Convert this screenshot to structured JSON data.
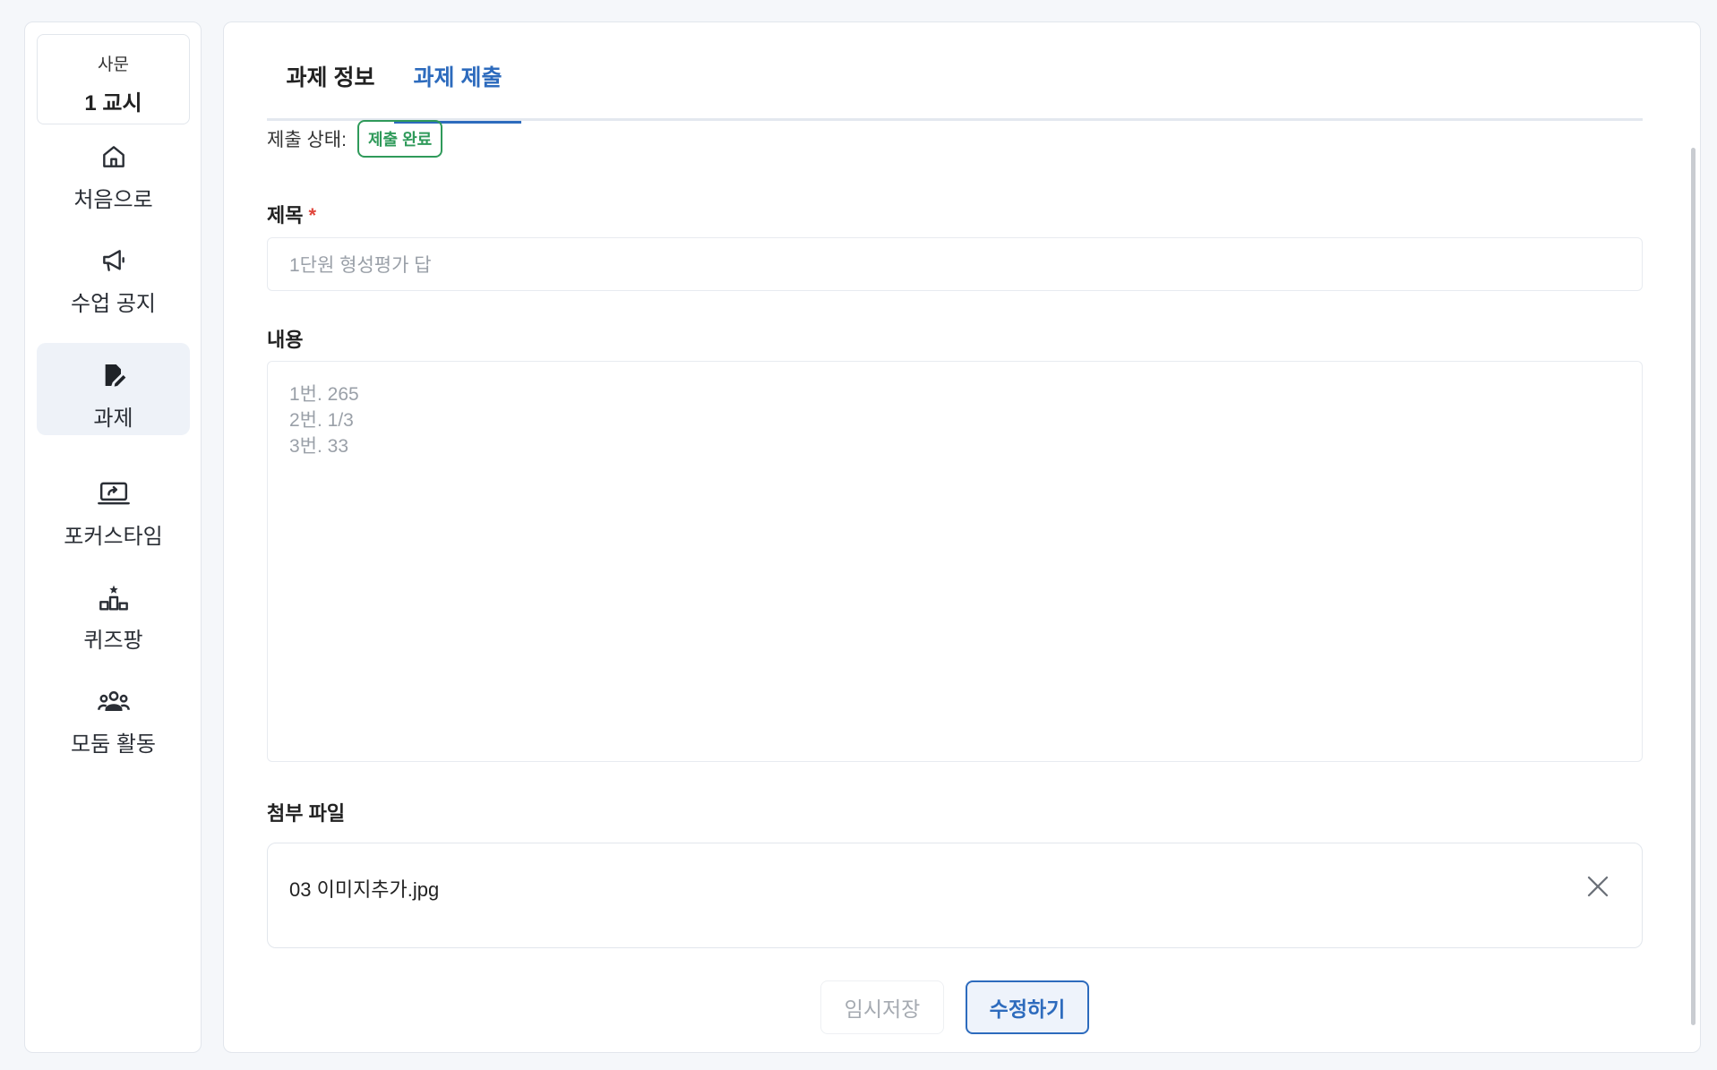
{
  "sidebar": {
    "class_card": {
      "subject": "사문",
      "period": "1 교시"
    },
    "items": [
      {
        "label": "처음으로",
        "icon": "home-icon"
      },
      {
        "label": "수업 공지",
        "icon": "megaphone-icon"
      },
      {
        "label": "과제",
        "icon": "assignment-edit-icon",
        "active": true
      },
      {
        "label": "포커스타임",
        "icon": "laptop-share-icon"
      },
      {
        "label": "퀴즈팡",
        "icon": "podium-star-icon"
      },
      {
        "label": "모둠 활동",
        "icon": "group-icon"
      }
    ]
  },
  "tabs": {
    "info": "과제 정보",
    "submit": "과제 제출",
    "active": "submit"
  },
  "status": {
    "label": "제출 상태:",
    "badge": "제출 완료",
    "badge_color": "#2f9a5a"
  },
  "form": {
    "title_label": "제목",
    "required_mark": "*",
    "title_value": "1단원 형성평가 답",
    "content_label": "내용",
    "content_value": "1번. 265\n2번. 1/3\n3번. 33",
    "attachment_label": "첨부 파일",
    "attachment_file": "03 이미지추가.jpg"
  },
  "buttons": {
    "draft": "임시저장",
    "edit": "수정하기"
  },
  "colors": {
    "accent": "#2d6bbd",
    "required": "#e0453b"
  }
}
